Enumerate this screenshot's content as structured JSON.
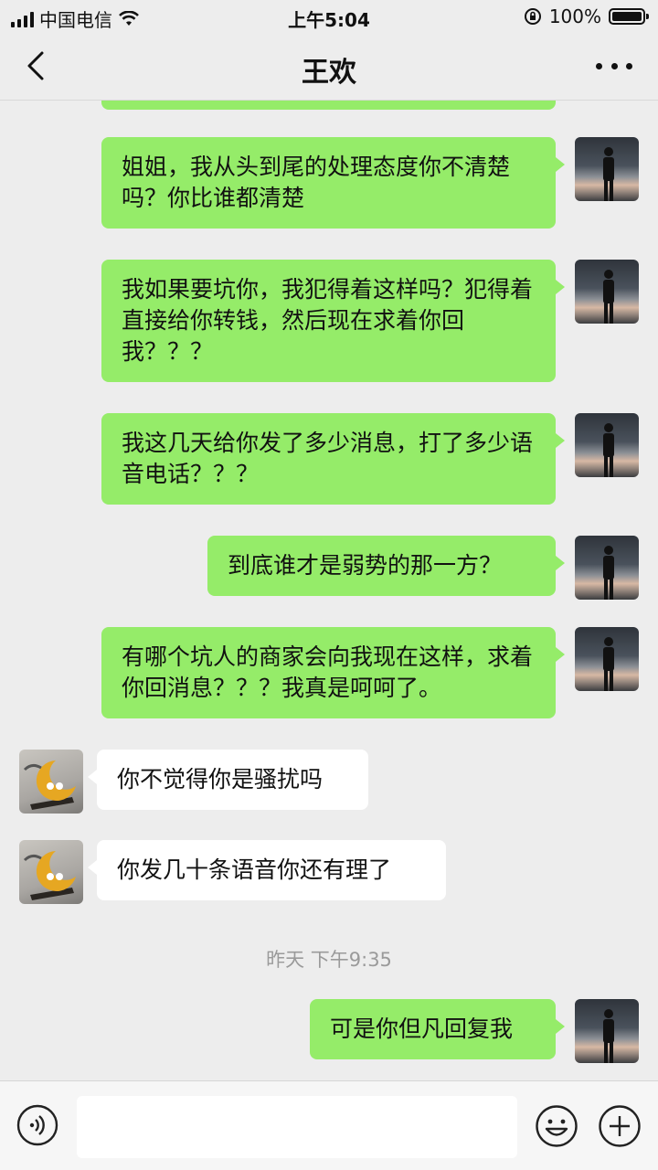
{
  "status_bar": {
    "carrier": "中国电信",
    "time": "上午5:04",
    "battery": "100%"
  },
  "nav": {
    "title": "王欢"
  },
  "messages": [
    {
      "side": "right",
      "text": "姐姐，我从头到尾的处理态度你不清楚吗？你比谁都清楚"
    },
    {
      "side": "right",
      "text": "我如果要坑你，我犯得着这样吗？犯得着直接给你转钱，然后现在求着你回我？？？"
    },
    {
      "side": "right",
      "text": "我这几天给你发了多少消息，打了多少语音电话？？？"
    },
    {
      "side": "right",
      "text": "到底谁才是弱势的那一方？"
    },
    {
      "side": "right",
      "text": "有哪个坑人的商家会向我现在这样，求着你回消息？？？我真是呵呵了。"
    },
    {
      "side": "left",
      "text": "你不觉得你是骚扰吗"
    },
    {
      "side": "left",
      "text": "你发几十条语音你还有理了"
    },
    {
      "side": "right",
      "text": "可是你但凡回复我"
    }
  ],
  "timestamp": "昨天 下午9:35",
  "colors": {
    "background": "#ededed",
    "my_bubble": "#95ec69",
    "their_bubble": "#ffffff"
  }
}
